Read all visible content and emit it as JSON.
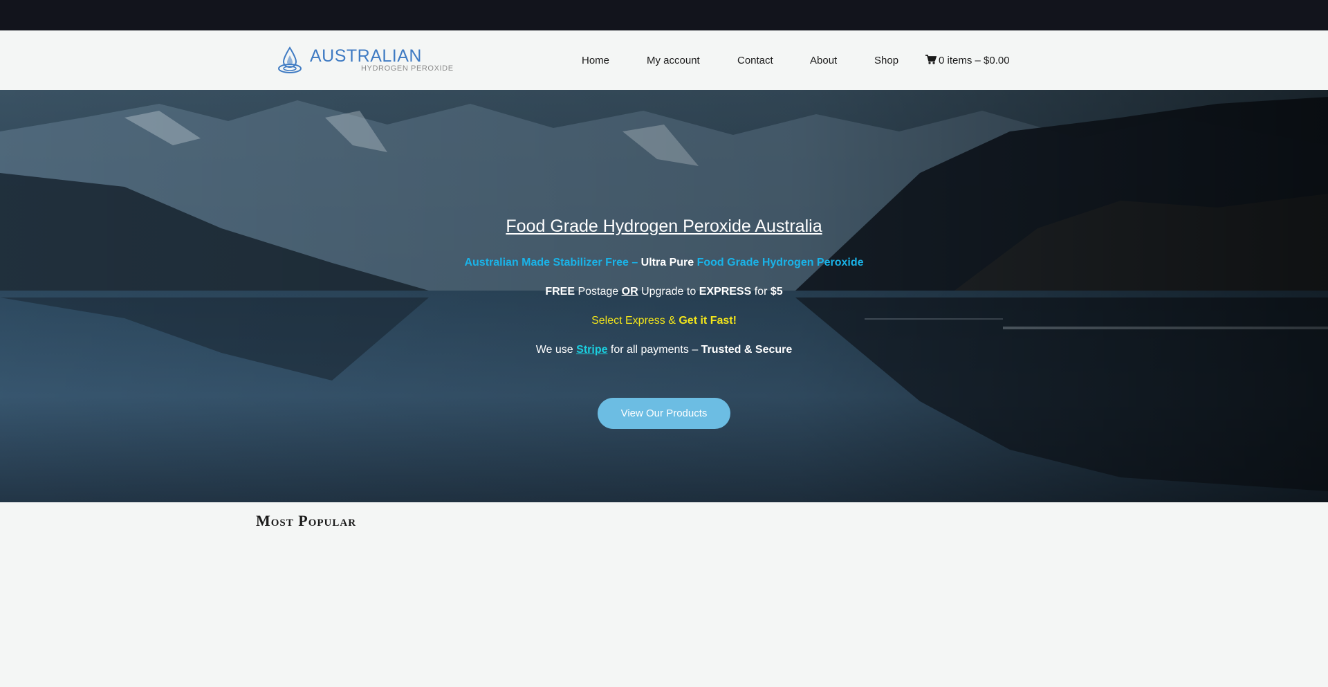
{
  "header": {
    "logo": {
      "main_text": "AUSTRALIAN",
      "sub_text": "HYDROGEN PEROXIDE",
      "icon": "water-drop-icon"
    },
    "nav": [
      {
        "label": "Home"
      },
      {
        "label": "My account"
      },
      {
        "label": "Contact"
      },
      {
        "label": "About"
      },
      {
        "label": "Shop"
      }
    ],
    "cart": {
      "icon": "shopping-cart-icon",
      "label": "0 items – $0.00"
    }
  },
  "hero": {
    "title": "Food Grade Hydrogen Peroxide Australia",
    "line1": {
      "part1": "Australian Made Stabilizer Free – ",
      "part2": "Ultra Pure",
      "part3": " Food Grade Hydrogen Peroxide"
    },
    "line2": {
      "free": "FREE",
      "postage": " Postage ",
      "or": "OR",
      "upgrade": " Upgrade to ",
      "express": "EXPRESS",
      "for": " for ",
      "price": "$5"
    },
    "line3": {
      "select": "Select Express & ",
      "get_it": "Get it Fast!"
    },
    "line4": {
      "we_use": "We use ",
      "stripe": "Stripe",
      "for_all": " for all payments – ",
      "trusted": "Trusted & Secure"
    },
    "cta_label": "View Our Products"
  },
  "section": {
    "title": "Most Popular"
  },
  "colors": {
    "accent_cyan": "#1ab3e8",
    "accent_yellow": "#f4e61a",
    "button": "#6cbde3",
    "topbar": "#12141c",
    "logo_blue": "#3f7bc3"
  }
}
